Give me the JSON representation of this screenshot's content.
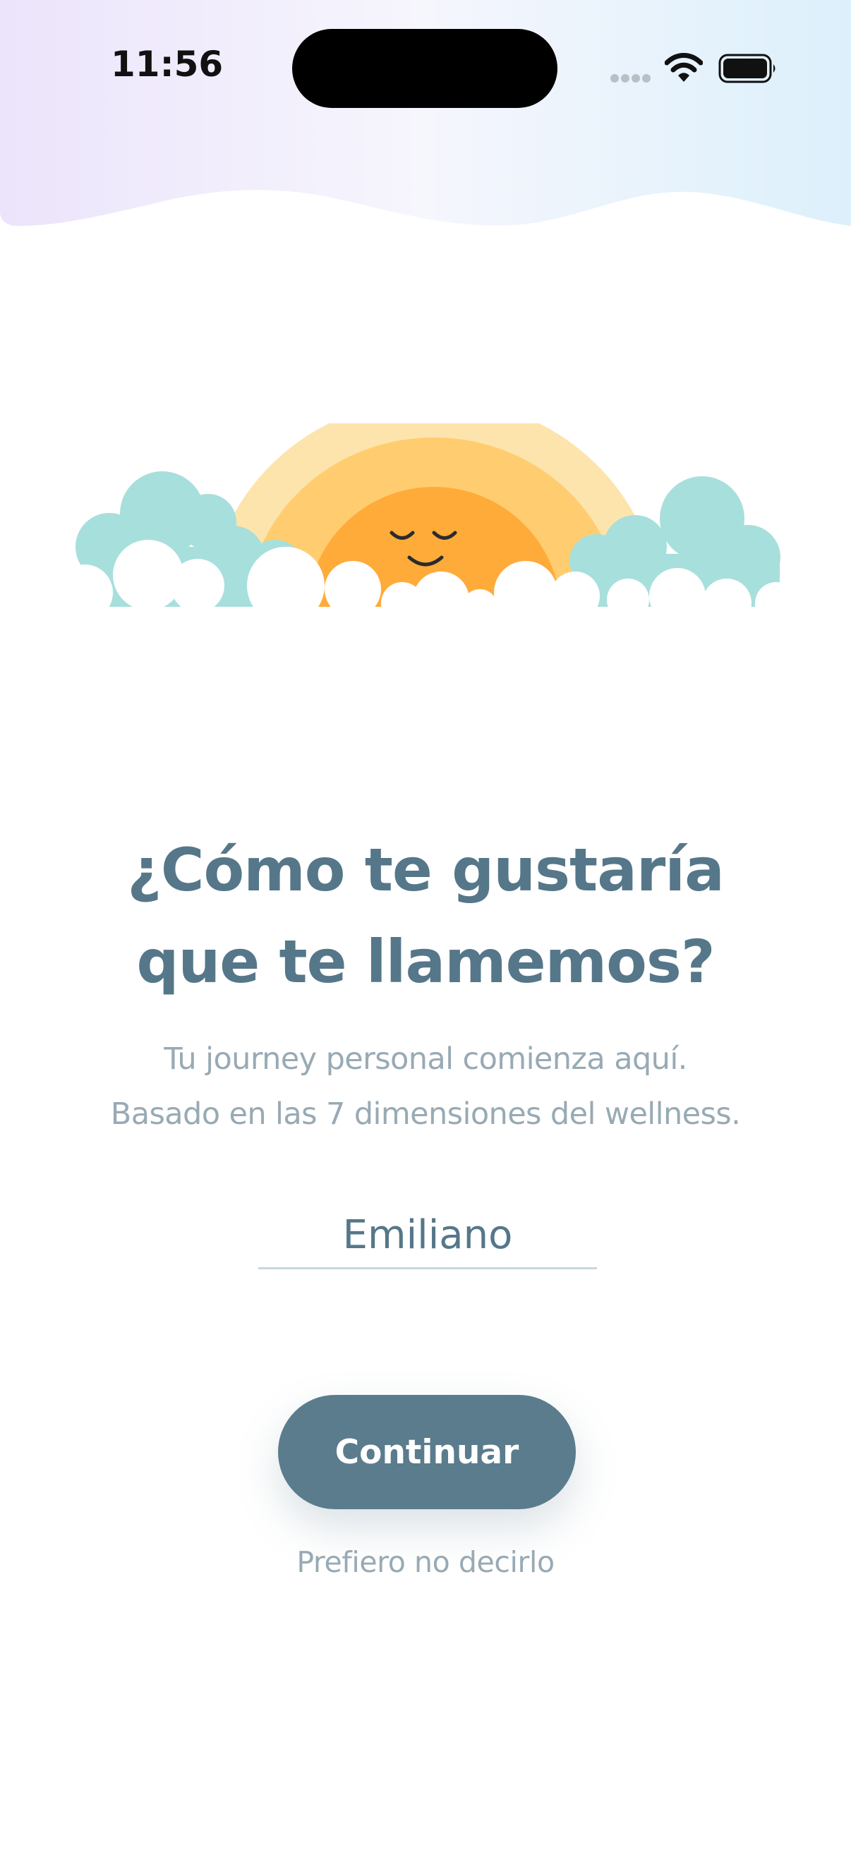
{
  "status_bar": {
    "time": "11:56"
  },
  "colors": {
    "accent": "#5a7c8d",
    "title": "#557789",
    "subtle_text": "#98aab4",
    "sun": "#ffab3a",
    "cloud_teal": "#a7dfdc"
  },
  "icons": {
    "signal": "signal-icon",
    "wifi": "wifi-icon",
    "battery": "battery-icon",
    "hero": "sleeping-sun-illustration"
  },
  "onboarding": {
    "title_line1": "¿Cómo te gustaría",
    "title_line2": "que te llamemos?",
    "subtitle_line1": "Tu journey personal comienza aquí.",
    "subtitle_line2": "Basado en las 7 dimensiones del wellness.",
    "name_value": "Emiliano",
    "continue_label": "Continuar",
    "skip_label": "Prefiero no decirlo"
  }
}
